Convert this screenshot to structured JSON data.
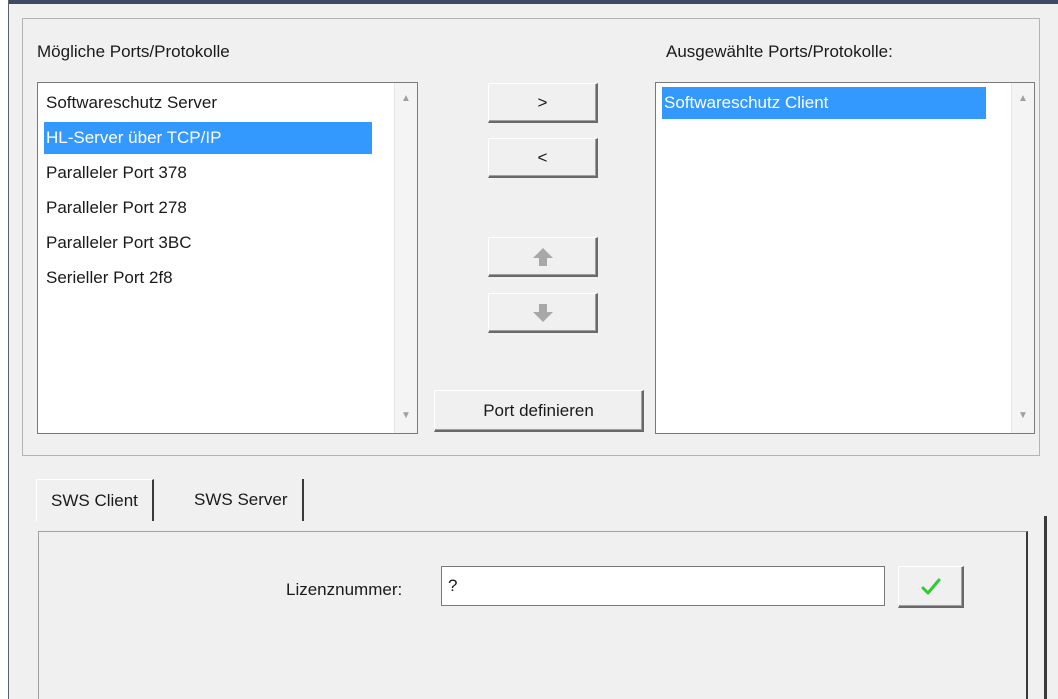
{
  "available": {
    "label": "Mögliche Ports/Protokolle",
    "items": [
      {
        "label": "Softwareschutz Server",
        "selected": false
      },
      {
        "label": "HL-Server über TCP/IP",
        "selected": true
      },
      {
        "label": "Paralleler Port 378",
        "selected": false
      },
      {
        "label": "Paralleler Port 278",
        "selected": false
      },
      {
        "label": "Paralleler Port 3BC",
        "selected": false
      },
      {
        "label": "Serieller Port 2f8",
        "selected": false
      }
    ]
  },
  "selected_list": {
    "label": "Ausgewählte Ports/Protokolle:",
    "items": [
      {
        "label": "Softwareschutz Client",
        "selected": true
      }
    ]
  },
  "buttons": {
    "add": ">",
    "remove": "<",
    "move_up_icon": "arrow-up-icon",
    "move_down_icon": "arrow-down-icon",
    "define_port": "Port definieren",
    "confirm_icon": "checkmark-icon"
  },
  "tabs": [
    {
      "label": "SWS Client",
      "active": true
    },
    {
      "label": "SWS Server",
      "active": false
    }
  ],
  "client": {
    "license_label": "Lizenznummer:",
    "license_value": "?"
  },
  "colors": {
    "selection": "#3399ff",
    "checkmark": "#2ecc2e",
    "arrow_disabled": "#a8a8a8"
  }
}
